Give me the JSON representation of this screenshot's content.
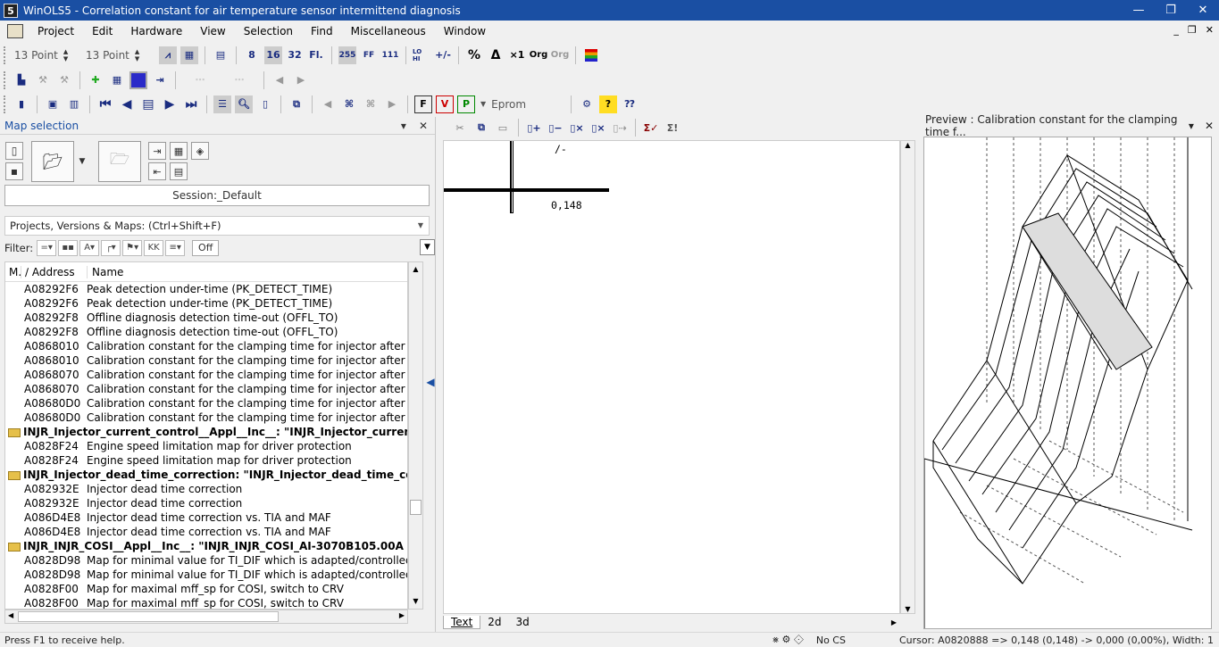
{
  "window": {
    "icon_label": "5",
    "title": "WinOLS5 - Correlation constant for air temperature sensor intermittend diagnosis",
    "min": "—",
    "max": "❐",
    "close": "✕"
  },
  "menu": {
    "items": [
      "Project",
      "Edit",
      "Hardware",
      "View",
      "Selection",
      "Find",
      "Miscellaneous",
      "Window"
    ],
    "right_controls": [
      "_",
      "❐",
      "✕"
    ]
  },
  "toolbar1": {
    "font1": "13 Point",
    "font2": "13 Point",
    "bits": [
      "8",
      "16",
      "32",
      "Fl."
    ],
    "formats": [
      "255",
      "FF",
      "111"
    ],
    "lohi": "LO HI",
    "plusminus": "+/-",
    "percent": "%",
    "delta": "Δ",
    "x1": "×1",
    "org": "Org",
    "org2": "Org"
  },
  "toolbar3": {
    "eprom": "Eprom"
  },
  "map_selection": {
    "title": "Map selection",
    "session": "Session:_Default",
    "search_placeholder": "Projects, Versions & Maps:  (Ctrl+Shift+F)",
    "filter_label": "Filter:",
    "filter_off": "Off",
    "columns": {
      "m": "M.",
      "address": "Address",
      "name": "Name"
    },
    "rows": [
      {
        "type": "item",
        "address": "A08292F6",
        "name": "Peak detection under-time (PK_DETECT_TIME)"
      },
      {
        "type": "item",
        "address": "A08292F6",
        "name": "Peak detection under-time (PK_DETECT_TIME)"
      },
      {
        "type": "item",
        "address": "A08292F8",
        "name": "Offline diagnosis detection time-out (OFFL_TO)"
      },
      {
        "type": "item",
        "address": "A08292F8",
        "name": "Offline diagnosis detection time-out (OFFL_TO)"
      },
      {
        "type": "item",
        "address": "A0868010",
        "name": "Calibration constant for the clamping time for injector after peak fo"
      },
      {
        "type": "item",
        "address": "A0868010",
        "name": "Calibration constant for the clamping time for injector after peak fo"
      },
      {
        "type": "item",
        "address": "A0868070",
        "name": "Calibration constant for the clamping time for injector after peak fo"
      },
      {
        "type": "item",
        "address": "A0868070",
        "name": "Calibration constant for the clamping time for injector after peak fo"
      },
      {
        "type": "item",
        "address": "A08680D0",
        "name": "Calibration constant for the clamping time for injector after peak fo"
      },
      {
        "type": "item",
        "address": "A08680D0",
        "name": "Calibration constant for the clamping time for injector after peak fo"
      },
      {
        "type": "group",
        "name": "INJR_Injector_current_control__Appl__Inc__: \"INJR_Injector_curren"
      },
      {
        "type": "item",
        "address": "A0828F24",
        "name": "Engine speed limitation map for driver protection"
      },
      {
        "type": "item",
        "address": "A0828F24",
        "name": "Engine speed limitation map for driver protection"
      },
      {
        "type": "group",
        "name": "INJR_Injector_dead_time_correction: \"INJR_Injector_dead_time_corr"
      },
      {
        "type": "item",
        "address": "A082932E",
        "name": "Injector dead time correction"
      },
      {
        "type": "item",
        "address": "A082932E",
        "name": "Injector dead time correction"
      },
      {
        "type": "item",
        "address": "A086D4E8",
        "name": "Injector dead time correction vs. TIA and MAF"
      },
      {
        "type": "item",
        "address": "A086D4E8",
        "name": "Injector dead time correction vs. TIA and MAF"
      },
      {
        "type": "group",
        "name": "INJR_INJR_COSI__Appl__Inc__: \"INJR_INJR_COSI_AI-3070B105.00A"
      },
      {
        "type": "item",
        "address": "A0828D98",
        "name": "Map for minimal value for TI_DIF which is adapted/controlled."
      },
      {
        "type": "item",
        "address": "A0828D98",
        "name": "Map for minimal value for TI_DIF which is adapted/controlled."
      },
      {
        "type": "item",
        "address": "A0828F00",
        "name": "Map for maximal mff_sp for COSI, switch to CRV"
      },
      {
        "type": "item",
        "address": "A0828F00",
        "name": "Map for maximal mff_sp for COSI, switch to CRV"
      }
    ]
  },
  "text_view": {
    "axis_label": "/-",
    "value": "0,148",
    "tabs": [
      "Text",
      "2d",
      "3d"
    ]
  },
  "preview": {
    "title": "Preview : Calibration constant for the clamping time f..."
  },
  "status": {
    "help": "Press F1 to receive help.",
    "cs": "No CS",
    "cursor": "Cursor: A0820888 => 0,148 (0,148) -> 0,000 (0,00%), Width: 1"
  }
}
